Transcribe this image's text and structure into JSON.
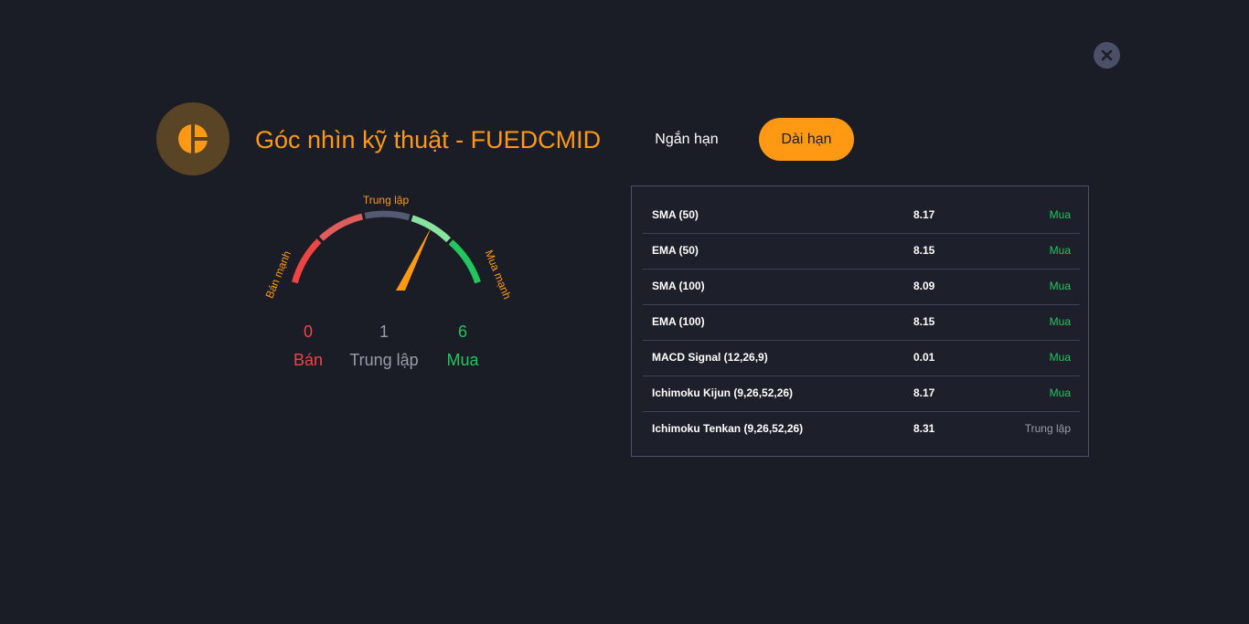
{
  "header": {
    "title": "Góc nhìn kỹ thuật - FUEDCMID",
    "logo_icon": "pie-chart-icon",
    "close_icon": "close-icon"
  },
  "tabs": [
    {
      "label": "Ngắn hạn",
      "active": false
    },
    {
      "label": "Dài hạn",
      "active": true
    }
  ],
  "gauge": {
    "top_label": "Trung lập",
    "left_label": "Bán mạnh",
    "right_label": "Mua mạnh",
    "needle_value": 0.7
  },
  "summary": {
    "sell": {
      "count": "0",
      "label": "Bán"
    },
    "neutral": {
      "count": "1",
      "label": "Trung lập"
    },
    "buy": {
      "count": "6",
      "label": "Mua"
    }
  },
  "indicators": [
    {
      "name": "SMA (50)",
      "value": "8.17",
      "signal": "Mua"
    },
    {
      "name": "EMA (50)",
      "value": "8.15",
      "signal": "Mua"
    },
    {
      "name": "SMA (100)",
      "value": "8.09",
      "signal": "Mua"
    },
    {
      "name": "EMA (100)",
      "value": "8.15",
      "signal": "Mua"
    },
    {
      "name": "MACD Signal (12,26,9)",
      "value": "0.01",
      "signal": "Mua"
    },
    {
      "name": "Ichimoku Kijun (9,26,52,26)",
      "value": "8.17",
      "signal": "Mua"
    },
    {
      "name": "Ichimoku Tenkan (9,26,52,26)",
      "value": "8.31",
      "signal": "Trung lập"
    }
  ],
  "colors": {
    "accent": "#ff9914",
    "sell": "#ef4444",
    "buy": "#22c55e",
    "neutral": "#9a9ca8",
    "background": "#1a1c26"
  }
}
